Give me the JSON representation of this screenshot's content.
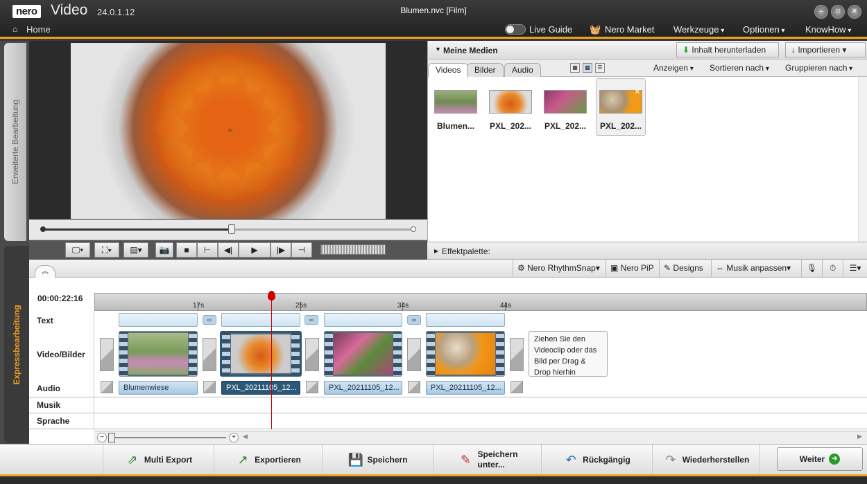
{
  "titlebar": {
    "logo": "nero",
    "app_name": "Video",
    "version": "24.0.1.12",
    "document_title": "Blumen.nvc [Film]",
    "home_label": "Home",
    "live_guide_label": "Live Guide",
    "market_label": "Nero Market",
    "menu": {
      "werkzeuge": "Werkzeuge",
      "optionen": "Optionen",
      "knowhow": "KnowHow"
    }
  },
  "left_tabs": {
    "advanced": "Erweiterte Bearbeitung",
    "express": "Expressbearbeitung"
  },
  "preview": {
    "seek_progress": 0.51
  },
  "media": {
    "title": "Meine Medien",
    "download_label": "Inhalt herunterladen",
    "import_label": "Importieren",
    "tabs": [
      "Videos",
      "Bilder",
      "Audio"
    ],
    "options": {
      "anzeigen": "Anzeigen",
      "sortieren": "Sortieren nach",
      "gruppieren": "Gruppieren nach"
    },
    "thumbnails": [
      "Blumen...",
      "PXL_202...",
      "PXL_202...",
      "PXL_202..."
    ]
  },
  "effekt_label": "Effektpalette:",
  "toolbar": {
    "rhythmsnap": "Nero RhythmSnap",
    "pip": "Nero PiP",
    "designs": "Designs",
    "musik": "Musik anpassen"
  },
  "timeline": {
    "timecode": "00:00:22:16",
    "ruler_labels": [
      "17s",
      "25s",
      "34s",
      "44s"
    ],
    "tracks": {
      "text": "Text",
      "video": "Video/Bilder",
      "audio": "Audio",
      "musik": "Musik",
      "sprache": "Sprache"
    },
    "clips": [
      "Blumenwiese",
      "PXL_20211105_12...",
      "PXL_20211105_12...",
      "PXL_20211105_12..."
    ],
    "drop_hint": "Ziehen Sie den Videoclip oder das Bild per Drag & Drop hierhin"
  },
  "bottom": {
    "multi_export": "Multi Export",
    "exportieren": "Exportieren",
    "speichern": "Speichern",
    "speichern_unter": "Speichern unter...",
    "rueckgaengig": "Rückgängig",
    "wiederherstellen": "Wiederherstellen",
    "weiter": "Weiter"
  }
}
